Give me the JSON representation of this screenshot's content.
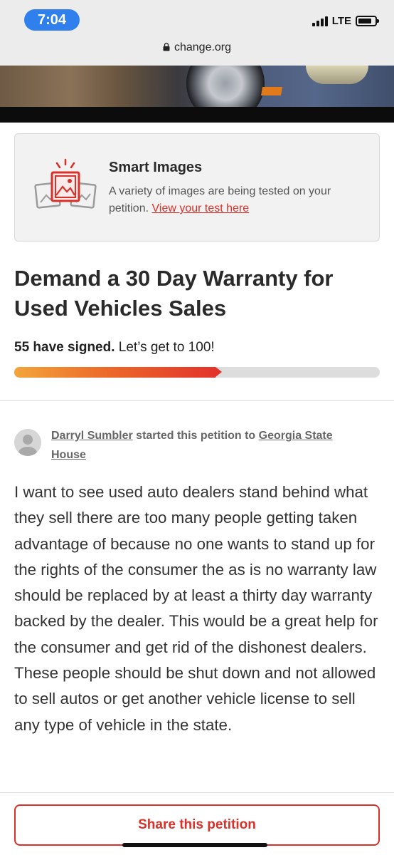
{
  "status_bar": {
    "time": "7:04",
    "network": "LTE",
    "icons": [
      "signal-icon",
      "battery-icon"
    ]
  },
  "browser": {
    "url": "change.org",
    "icon": "lock-icon"
  },
  "smart_images": {
    "title": "Smart Images",
    "description": "A variety of images are being tested on your petition.",
    "link_text": "View your test here",
    "icon": "smart-images-icon"
  },
  "petition": {
    "title": "Demand a 30 Day Warranty for Used Vehicles Sales",
    "signed_count": "55 have signed.",
    "goal_text": "Let’s get to 100!",
    "progress": {
      "signed": 55,
      "goal": 100,
      "fraction": 0.55
    },
    "starter_name": "Darryl Sumbler",
    "started_text": "started this petition to",
    "target": "Georgia State House",
    "body": "I want to see used auto dealers stand behind what they sell there are too many people getting taken advantage of because no one wants to stand up for the rights of the consumer the as is no warranty law should be replaced by at least a thirty day warranty backed by the dealer. This would be a great help for the consumer and get rid of the dishonest dealers. These people should be shut down and not allowed to sell autos or get another vehicle license to sell any type of vehicle in the state."
  },
  "share": {
    "label": "Share this petition"
  },
  "colors": {
    "accent": "#d9312a",
    "progress_start": "#f2a53b",
    "progress_end": "#e2342b",
    "time_pill": "#2f80ed"
  }
}
